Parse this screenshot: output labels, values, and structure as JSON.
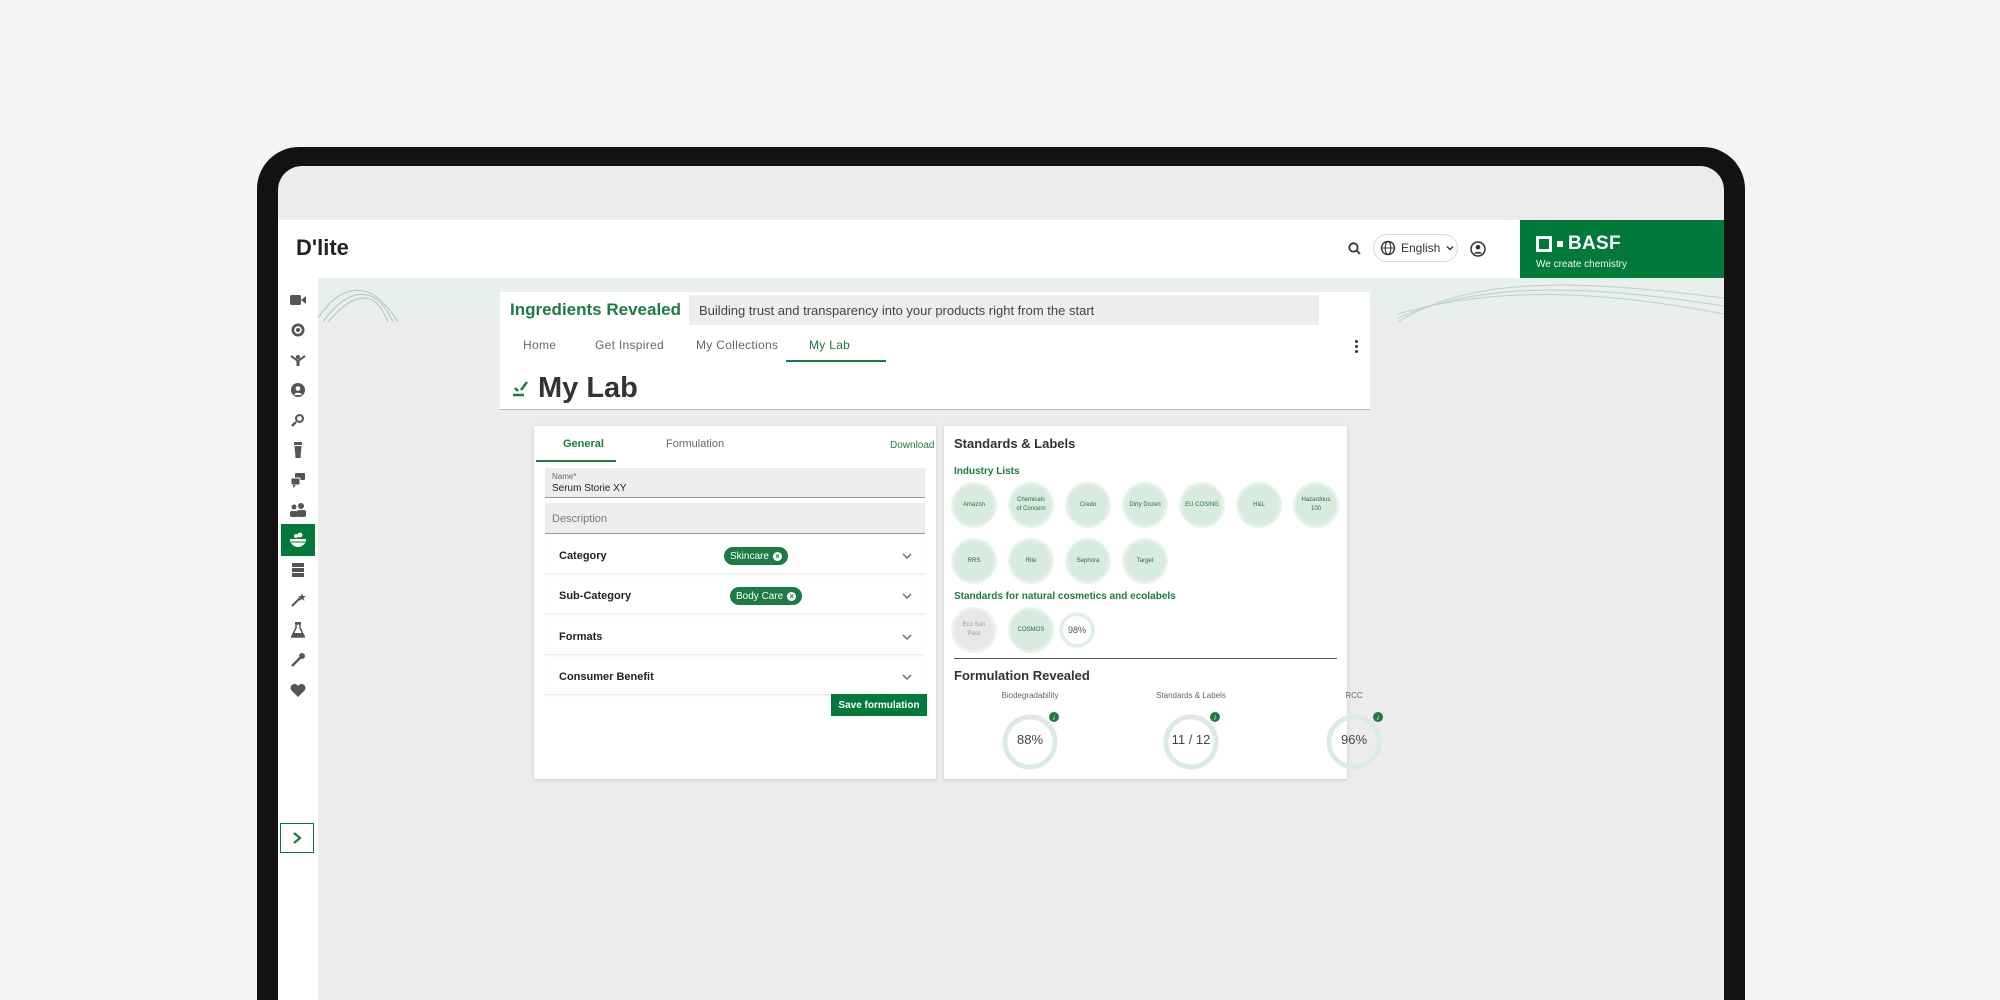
{
  "header": {
    "brand": "D'lite",
    "language": "English",
    "company": {
      "name": "BASF",
      "tagline": "We create chemistry",
      "color": "#00793a"
    }
  },
  "sidebar": {
    "items": [
      {
        "icon": "video-icon"
      },
      {
        "icon": "target-icon"
      },
      {
        "icon": "figure-icon"
      },
      {
        "icon": "face-icon"
      },
      {
        "icon": "magnifier-icon"
      },
      {
        "icon": "bottle-icon"
      },
      {
        "icon": "chat-icon"
      },
      {
        "icon": "group-icon"
      },
      {
        "icon": "lab-bowl-icon",
        "active": true
      },
      {
        "icon": "database-icon"
      },
      {
        "icon": "wand-icon"
      },
      {
        "icon": "flask-icon"
      },
      {
        "icon": "pipette-icon"
      },
      {
        "icon": "heart-icon"
      }
    ],
    "expand_icon": "chevron-right-icon"
  },
  "banner": {
    "title": "Ingredients Revealed",
    "subtitle": "Building trust and transparency into your products right from the start"
  },
  "nav": {
    "tabs": [
      "Home",
      "Get Inspired",
      "My Collections",
      "My Lab"
    ],
    "active": "My Lab"
  },
  "page": {
    "title": "My Lab"
  },
  "formulation_card": {
    "tabs": [
      "General",
      "Formulation"
    ],
    "active_tab": "General",
    "download_label": "Download",
    "name_label": "Name*",
    "name_value": "Serum Storie XY",
    "description_placeholder": "Description",
    "accordions": [
      {
        "label": "Category",
        "chip": "Skincare"
      },
      {
        "label": "Sub-Category",
        "chip": "Body Care"
      },
      {
        "label": "Formats",
        "chip": ""
      },
      {
        "label": "Consumer Benefit",
        "chip": ""
      }
    ],
    "save_label": "Save formulation"
  },
  "standards_card": {
    "title": "Standards & Labels",
    "industry_lists_label": "Industry Lists",
    "industry_lists": [
      "Amazon",
      "Chemicals of Concern",
      "Credo",
      "Dirty Dozen",
      "EU COSING",
      "H&L",
      "Hazardous 100",
      "RRS",
      "Rite",
      "Sephora",
      "Target"
    ],
    "natural_label": "Standards for natural cosmetics and ecolabels",
    "natural": [
      {
        "name": "Eco Sun Pass",
        "status": "inactive"
      },
      {
        "name": "COSMOS",
        "status": "active"
      },
      {
        "name": "98%",
        "status": "score"
      }
    ],
    "revealed_title": "Formulation Revealed",
    "metrics": [
      {
        "label": "Biodegradability",
        "value": "88%",
        "fraction": 0.88
      },
      {
        "label": "Standards & Labels",
        "value": "11 / 12",
        "fraction": 0.9167
      },
      {
        "label": "RCC",
        "value": "96%",
        "fraction": 0.96
      }
    ],
    "accent": "#1d7a45",
    "ring_track": "#dcebe2"
  }
}
